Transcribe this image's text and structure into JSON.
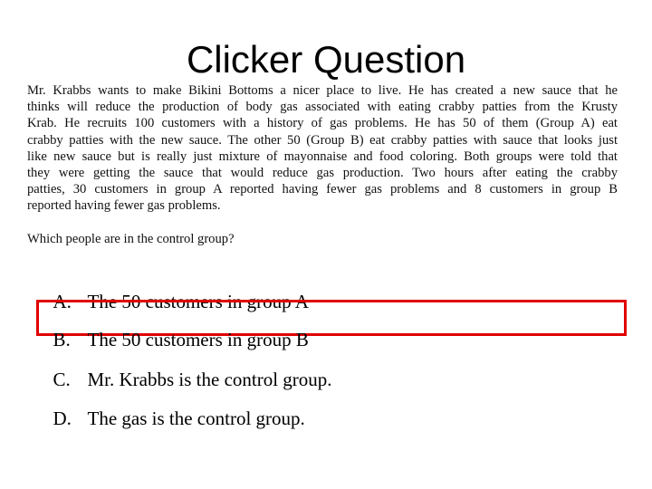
{
  "slide": {
    "title": "Clicker Question",
    "passage_lines": [
      "Mr. Krabbs wants to make Bikini Bottoms a nicer place to live. He has created a new sauce that he",
      "thinks will reduce the production of body gas associated with eating crabby patties from the Krusty",
      "Krab. He recruits 100 customers with a history of gas problems. He has 50 of them (Group A) eat",
      "crabby patties with the new sauce. The other 50 (Group B) eat crabby patties with sauce that looks just",
      "like new sauce but is really just mixture of mayonnaise and food coloring. Both groups were told that",
      "they were getting the sauce that would reduce gas production. Two hours after eating the crabby",
      "patties, 30 customers in group A reported having fewer gas problems and 8 customers in group B",
      "reported having fewer gas problems."
    ],
    "question": "Which people are in the control group?",
    "options": [
      {
        "letter": "A.",
        "text": "The 50 customers in group A"
      },
      {
        "letter": "B.",
        "text": "The 50 customers in group B"
      },
      {
        "letter": "C.",
        "text": "Mr. Krabbs is the control group."
      },
      {
        "letter": "D.",
        "text": "The gas is the control group."
      }
    ],
    "highlighted_option": "B",
    "highlight_color": "#e00000"
  }
}
